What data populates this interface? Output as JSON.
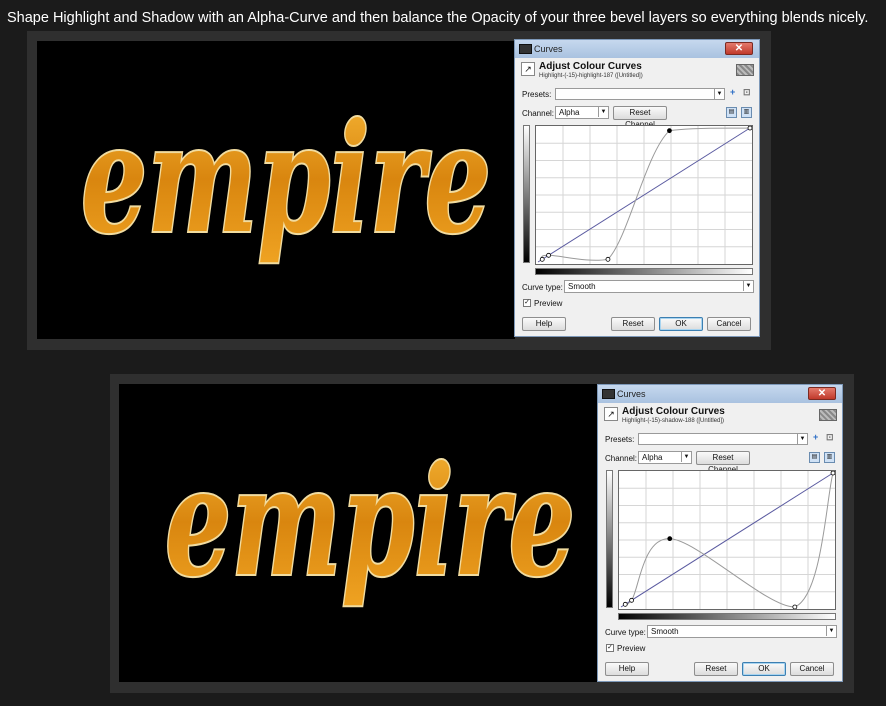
{
  "caption": "Shape Highlight and Shadow with an Alpha-Curve and then balance the Opacity of your three bevel layers so everything blends nicely.",
  "artwork_text": "empire",
  "colors": {
    "background": "#1b1b1b",
    "panel": "#2f2f2f",
    "text_fill": "#e39a17",
    "text_rim": "#f1dca0"
  },
  "dialogs": [
    {
      "window_title": "Curves",
      "close_label": "✕",
      "header_title": "Adjust Colour Curves",
      "header_subtitle": "Highlight-(-15)-highlight-187 ([Untitled])",
      "presets_label": "Presets:",
      "presets_value": "",
      "channel_label": "Channel:",
      "channel_value": "Alpha",
      "reset_channel_label": "Reset Channel",
      "curve_type_label": "Curve type:",
      "curve_type_value": "Smooth",
      "preview_label": "Preview",
      "preview_checked": true,
      "help_label": "Help",
      "reset_label": "Reset",
      "ok_label": "OK",
      "cancel_label": "Cancel",
      "control_points": [
        [
          0.02,
          0.02
        ],
        [
          0.05,
          0.05
        ],
        [
          0.33,
          0.02
        ],
        [
          0.62,
          0.98
        ],
        [
          1.0,
          1.0
        ]
      ]
    },
    {
      "window_title": "Curves",
      "close_label": "✕",
      "header_title": "Adjust Colour Curves",
      "header_subtitle": "Highlight-(-15)-shadow-188 ([Untitled])",
      "presets_label": "Presets:",
      "presets_value": "",
      "channel_label": "Channel:",
      "channel_value": "Alpha",
      "reset_channel_label": "Reset Channel",
      "curve_type_label": "Curve type:",
      "curve_type_value": "Smooth",
      "preview_label": "Preview",
      "preview_checked": true,
      "help_label": "Help",
      "reset_label": "Reset",
      "ok_label": "OK",
      "cancel_label": "Cancel",
      "control_points": [
        [
          0.02,
          0.02
        ],
        [
          0.05,
          0.05
        ],
        [
          0.23,
          0.51
        ],
        [
          0.82,
          0.0
        ],
        [
          1.0,
          1.0
        ]
      ]
    }
  ]
}
